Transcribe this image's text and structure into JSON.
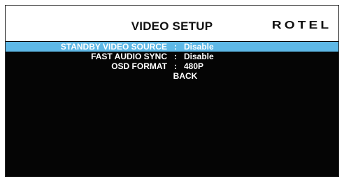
{
  "header": {
    "title": "VIDEO SETUP",
    "brand": "ROTEL"
  },
  "menu": {
    "items": [
      {
        "label": "STANDBY VIDEO SOURCE",
        "separator": ":",
        "value": "Disable",
        "selected": true
      },
      {
        "label": "FAST AUDIO SYNC",
        "separator": ":",
        "value": "Disable",
        "selected": false
      },
      {
        "label": "OSD FORMAT",
        "separator": ":",
        "value": "480P",
        "selected": false
      },
      {
        "label": "BACK",
        "selected": false
      }
    ]
  },
  "colors": {
    "highlight": "#5eb8e6",
    "background": "#050505",
    "header_bg": "#ffffff",
    "text": "#ffffff"
  }
}
